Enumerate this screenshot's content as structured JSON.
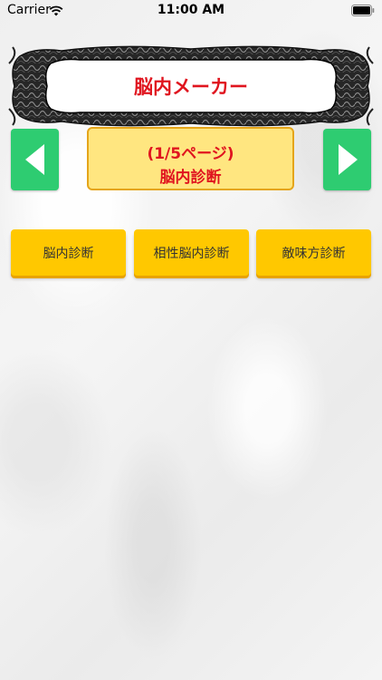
{
  "status_bar": {
    "carrier": "Carrier",
    "time": "11:00 AM"
  },
  "header": {
    "title": "脳内メーカー"
  },
  "pager": {
    "counter": "(1/5ページ)",
    "name": "脳内診断"
  },
  "buttons": [
    "脳内診断",
    "相性脳内診断",
    "敵味方診断"
  ],
  "icons": {
    "prev": "arrow-left-icon",
    "next": "arrow-right-icon"
  },
  "colors": {
    "nav_green": "#2ecc71",
    "title_red": "#e0151f",
    "button_yellow": "#ffc800",
    "pager_bg": "#ffe680"
  }
}
